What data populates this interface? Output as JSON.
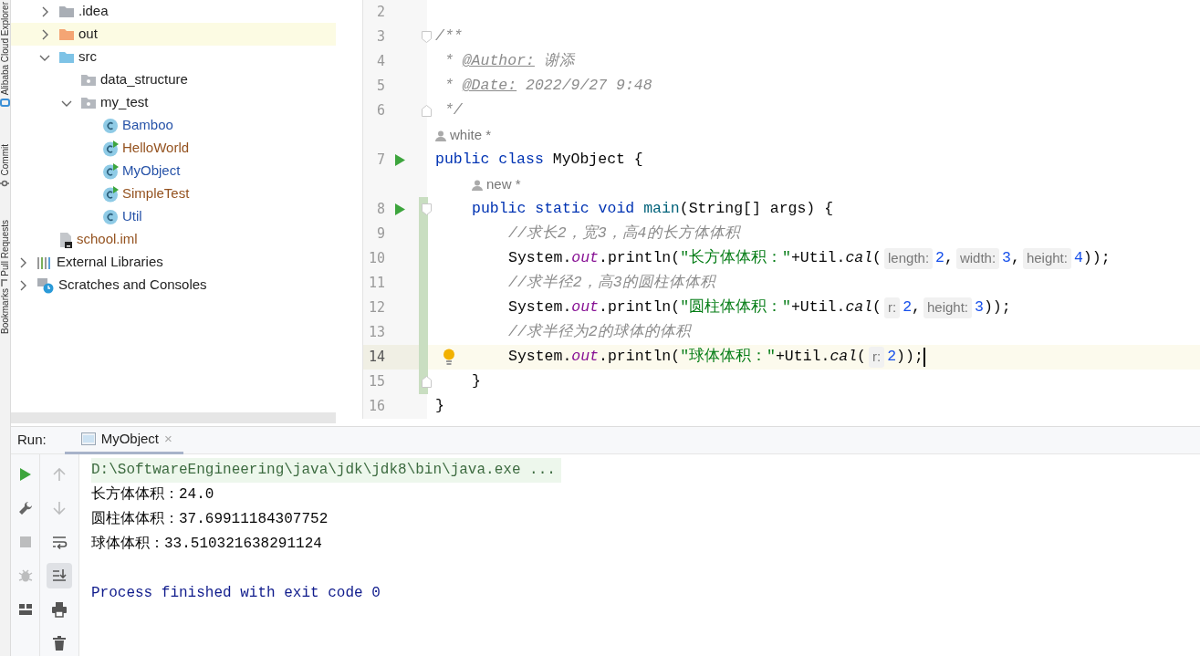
{
  "tool_strip": [
    {
      "label": "Alibaba Cloud Explorer",
      "kind": "cloud"
    },
    {
      "label": "Commit",
      "kind": "commit"
    },
    {
      "label": "Pull Requests",
      "kind": "pull"
    },
    {
      "label": "Bookmarks",
      "kind": "plain"
    }
  ],
  "project_tree": [
    {
      "children": [
        {
          "label": ".idea",
          "kind": "folder",
          "expanded": false,
          "highlighted": false,
          "color": "#222222"
        },
        {
          "label": "out",
          "kind": "excluded-folder",
          "expanded": false,
          "highlighted": true,
          "color": "#222222"
        },
        {
          "label": "src",
          "kind": "source-folder",
          "expanded": true,
          "highlighted": false,
          "color": "#222222",
          "children": [
            {
              "label": "data_structure",
              "kind": "package",
              "highlighted": false,
              "color": "#222222"
            },
            {
              "label": "my_test",
              "kind": "package",
              "expanded": true,
              "highlighted": false,
              "color": "#222222",
              "children": [
                {
                  "label": "Bamboo",
                  "kind": "class",
                  "highlighted": false,
                  "color": "#2753a8"
                },
                {
                  "label": "HelloWorld",
                  "kind": "runnable-class",
                  "highlighted": false,
                  "color": "#94521f"
                },
                {
                  "label": "MyObject",
                  "kind": "runnable-class",
                  "highlighted": false,
                  "color": "#2753a8"
                },
                {
                  "label": "SimpleTest",
                  "kind": "runnable-class",
                  "highlighted": false,
                  "color": "#94521f"
                },
                {
                  "label": "Util",
                  "kind": "class",
                  "highlighted": false,
                  "color": "#2753a8"
                }
              ]
            }
          ]
        },
        {
          "label": "school.iml",
          "kind": "module-file",
          "highlighted": false,
          "color": "#94521f"
        }
      ]
    },
    {
      "label": "External Libraries",
      "kind": "libraries",
      "expanded": false,
      "highlighted": false,
      "color": "#222222"
    },
    {
      "label": "Scratches and Consoles",
      "kind": "scratches",
      "expanded": false,
      "highlighted": false,
      "color": "#222222"
    }
  ],
  "editor": {
    "lines": [
      {
        "kind": "code",
        "number": "2"
      },
      {
        "kind": "code",
        "number": "3",
        "fold_open": true,
        "tokens": [
          {
            "kind": "doc",
            "t": "/**"
          }
        ]
      },
      {
        "kind": "code",
        "number": "4",
        "tokens": [
          {
            "kind": "doc",
            "t": " * "
          },
          {
            "kind": "doctag",
            "t": "@Author:"
          },
          {
            "kind": "doc",
            "t": " 谢添"
          }
        ]
      },
      {
        "kind": "code",
        "number": "5",
        "tokens": [
          {
            "kind": "doc",
            "t": " * "
          },
          {
            "kind": "doctag",
            "t": "@Date:"
          },
          {
            "kind": "doc",
            "t": " 2022/9/27 9:48"
          }
        ]
      },
      {
        "kind": "code",
        "number": "6",
        "fold_close": true,
        "tokens": [
          {
            "kind": "doc",
            "t": " */"
          }
        ]
      },
      {
        "kind": "author",
        "text": "white *"
      },
      {
        "kind": "code",
        "number": "7",
        "run": true,
        "tokens": [
          {
            "kind": "kw",
            "t": "public class"
          },
          {
            "kind": "plain",
            "t": " MyObject {"
          }
        ]
      },
      {
        "kind": "author",
        "text": "new *"
      },
      {
        "kind": "code",
        "number": "8",
        "run": true,
        "fold_open": true,
        "changed": true,
        "tokens": [
          {
            "kind": "kw",
            "t": "    public static void"
          },
          {
            "kind": "decl",
            "t": " main"
          },
          {
            "kind": "plain",
            "t": "(String[] args) {"
          }
        ]
      },
      {
        "kind": "code",
        "number": "9",
        "changed": true,
        "tokens": [
          {
            "kind": "comment",
            "t": "        //求长2，宽3，高4的长方体体积"
          }
        ]
      },
      {
        "kind": "code",
        "number": "10",
        "changed": true,
        "tokens": [
          {
            "kind": "plain",
            "t": "        System."
          },
          {
            "kind": "field",
            "t": "out"
          },
          {
            "kind": "plain",
            "t": ".println("
          },
          {
            "kind": "string",
            "t": "\"长方体体积：\""
          },
          {
            "kind": "plain",
            "t": "+Util."
          },
          {
            "kind": "smethod",
            "t": "cal"
          },
          {
            "kind": "plain",
            "t": "("
          },
          {
            "kind": "hint",
            "t": "length:"
          },
          {
            "kind": "num",
            "t": "2"
          },
          {
            "kind": "plain",
            "t": ","
          },
          {
            "kind": "hint",
            "t": "width:"
          },
          {
            "kind": "num",
            "t": "3"
          },
          {
            "kind": "plain",
            "t": ","
          },
          {
            "kind": "hint",
            "t": "height:"
          },
          {
            "kind": "num",
            "t": "4"
          },
          {
            "kind": "plain",
            "t": "));"
          }
        ]
      },
      {
        "kind": "code",
        "number": "11",
        "changed": true,
        "tokens": [
          {
            "kind": "comment",
            "t": "        //求半径2，高3的圆柱体体积"
          }
        ]
      },
      {
        "kind": "code",
        "number": "12",
        "changed": true,
        "tokens": [
          {
            "kind": "plain",
            "t": "        System."
          },
          {
            "kind": "field",
            "t": "out"
          },
          {
            "kind": "plain",
            "t": ".println("
          },
          {
            "kind": "string",
            "t": "\"圆柱体体积：\""
          },
          {
            "kind": "plain",
            "t": "+Util."
          },
          {
            "kind": "smethod",
            "t": "cal"
          },
          {
            "kind": "plain",
            "t": "("
          },
          {
            "kind": "hint",
            "t": "r:"
          },
          {
            "kind": "num",
            "t": "2"
          },
          {
            "kind": "plain",
            "t": ","
          },
          {
            "kind": "hint",
            "t": "height:"
          },
          {
            "kind": "num",
            "t": "3"
          },
          {
            "kind": "plain",
            "t": "));"
          }
        ]
      },
      {
        "kind": "code",
        "number": "13",
        "changed": true,
        "tokens": [
          {
            "kind": "comment",
            "t": "        //求半径为2的球体的体积"
          }
        ]
      },
      {
        "kind": "code",
        "number": "14",
        "changed": true,
        "bulb": true,
        "current": true,
        "caret": true,
        "tokens": [
          {
            "kind": "plain",
            "t": "        System."
          },
          {
            "kind": "field",
            "t": "out"
          },
          {
            "kind": "plain",
            "t": ".println("
          },
          {
            "kind": "string",
            "t": "\"球体体积：\""
          },
          {
            "kind": "plain",
            "t": "+Util."
          },
          {
            "kind": "smethod",
            "t": "cal"
          },
          {
            "kind": "plain",
            "t": "("
          },
          {
            "kind": "hint",
            "t": "r:"
          },
          {
            "kind": "num",
            "t": "2"
          },
          {
            "kind": "plain",
            "t": "));"
          }
        ]
      },
      {
        "kind": "code",
        "number": "15",
        "fold_close": true,
        "changed": true,
        "tokens": [
          {
            "kind": "plain",
            "t": "    }"
          }
        ]
      },
      {
        "kind": "code",
        "number": "16",
        "tokens": [
          {
            "kind": "plain",
            "t": "}"
          }
        ]
      }
    ]
  },
  "run_panel": {
    "label": "Run:",
    "tabs": [
      {
        "label": "MyObject",
        "selected": true,
        "close": "×"
      }
    ],
    "left_tools": [
      {
        "kind": "run",
        "disabled": false,
        "active": false
      },
      {
        "kind": "wrench",
        "disabled": false,
        "active": false
      },
      {
        "kind": "stop",
        "disabled": true,
        "active": false
      },
      {
        "kind": "debug",
        "disabled": true,
        "active": false
      },
      {
        "kind": "layout",
        "disabled": false,
        "active": false
      }
    ],
    "right_tools": [
      {
        "kind": "up",
        "disabled": true,
        "active": false
      },
      {
        "kind": "down",
        "disabled": true,
        "active": false
      },
      {
        "kind": "wrap",
        "disabled": false,
        "active": false
      },
      {
        "kind": "scroll-end",
        "disabled": false,
        "active": true
      },
      {
        "kind": "print",
        "disabled": false,
        "active": false
      },
      {
        "kind": "trash",
        "disabled": false,
        "active": false
      }
    ],
    "console": [
      {
        "kind": "command",
        "text": "D:\\SoftwareEngineering\\java\\jdk\\jdk8\\bin\\java.exe ..."
      },
      {
        "kind": "output",
        "text": "长方体体积：24.0"
      },
      {
        "kind": "output",
        "text": "圆柱体体积：37.69911184307752"
      },
      {
        "kind": "output",
        "text": "球体体积：33.510321638291124"
      },
      {
        "kind": "blank"
      },
      {
        "kind": "exit",
        "text": "Process finished with exit code 0"
      }
    ]
  }
}
